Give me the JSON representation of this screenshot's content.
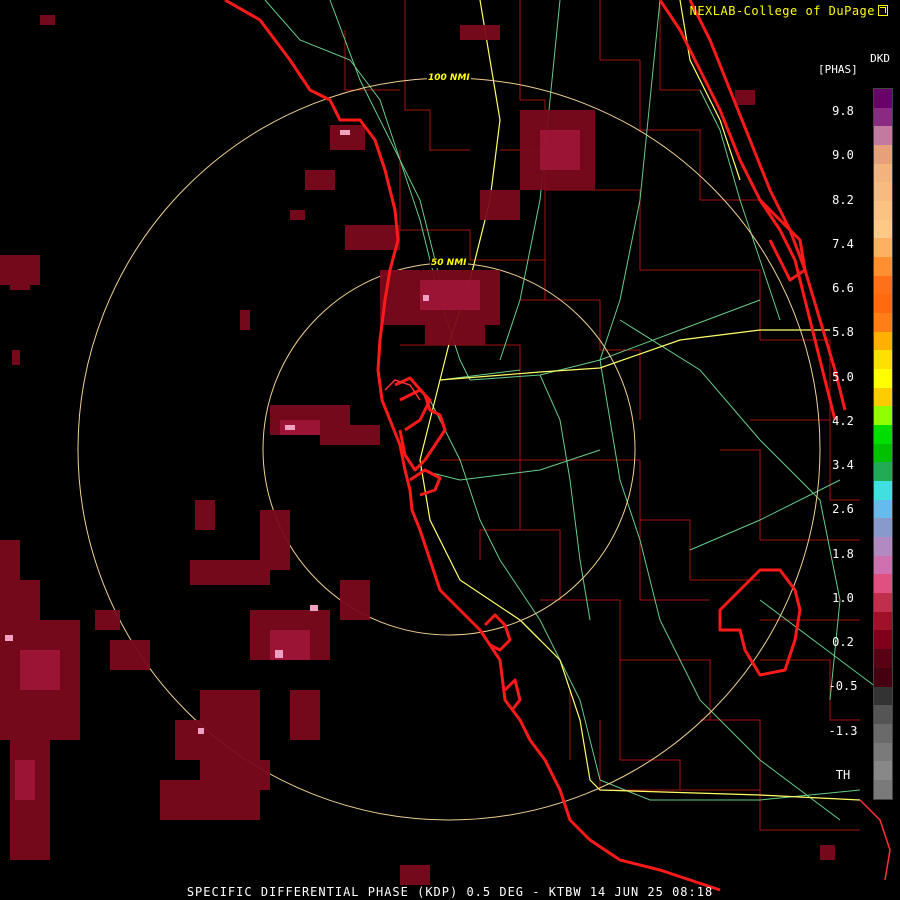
{
  "header": {
    "credit": "NEXLAB-College of DuPage",
    "product_code": "DKD",
    "unit": "[PHAS]"
  },
  "rings": [
    {
      "label": "100 NMI",
      "radius_nmi": 100
    },
    {
      "label": "50 NMI",
      "radius_nmi": 50
    }
  ],
  "legend": {
    "labels": [
      "9.8",
      "9.0",
      "8.2",
      "7.4",
      "6.6",
      "5.8",
      "5.0",
      "4.2",
      "3.4",
      "2.6",
      "1.8",
      "1.0",
      "0.2",
      "-0.5",
      "-1.3",
      "TH"
    ],
    "colors": [
      "#6a006a",
      "#8a2a82",
      "#c47aa0",
      "#e8a07a",
      "#f4b27c",
      "#f7bb80",
      "#fbc382",
      "#fdc984",
      "#ffb060",
      "#ff8f30",
      "#ff7018",
      "#ff6a10",
      "#ff7e16",
      "#ffb000",
      "#ffe000",
      "#ffff00",
      "#ffcc00",
      "#90ff00",
      "#00dd00",
      "#00c000",
      "#22aa55",
      "#40e0e0",
      "#66bbee",
      "#8899cc",
      "#b08ac0",
      "#d070b0",
      "#e05080",
      "#c0304c",
      "#a01028",
      "#80001c",
      "#5a0014",
      "#440010",
      "#333333",
      "#555555",
      "#6a6a6a",
      "#7a7a7a",
      "#888888",
      "#7a7a7a"
    ]
  },
  "footer": {
    "product_line": "SPECIFIC DIFFERENTIAL PHASE (KDP) 0.5 DEG - KTBW 14 JUN 25 08:18"
  },
  "colors": {
    "coastline": "#ff1a1a",
    "county": "#aa1111",
    "interstate": "#ffff66",
    "highway": "#66cc88",
    "rings": "#f0d090",
    "echo_dark": "#7a0a1c",
    "echo_mid": "#a0163a",
    "echo_light": "#f0a0c0"
  }
}
